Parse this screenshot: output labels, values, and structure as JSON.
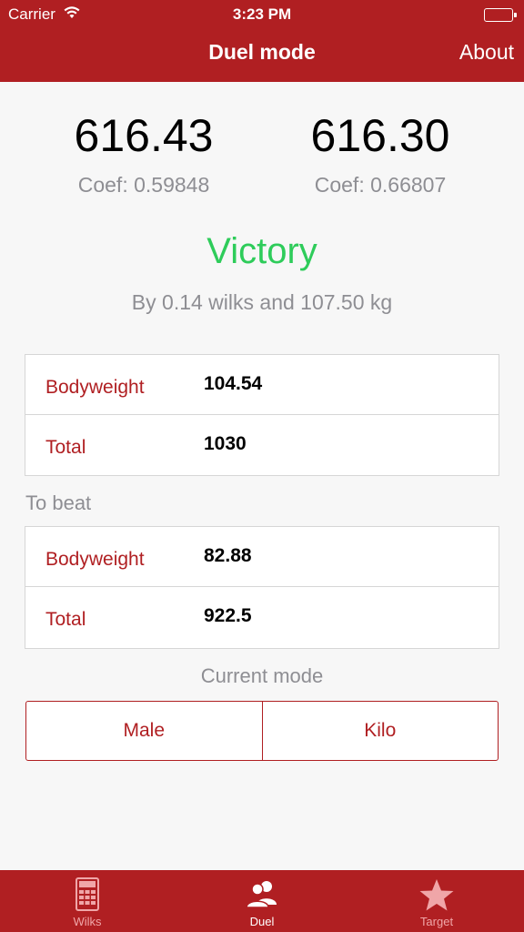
{
  "status_bar": {
    "carrier": "Carrier",
    "time": "3:23 PM"
  },
  "nav": {
    "title": "Duel mode",
    "about": "About"
  },
  "scores": {
    "left": {
      "value": "616.43",
      "coef": "Coef: 0.59848"
    },
    "right": {
      "value": "616.30",
      "coef": "Coef: 0.66807"
    }
  },
  "result": {
    "label": "Victory",
    "detail": "By 0.14 wilks and 107.50 kg"
  },
  "you": {
    "rows": [
      {
        "label": "Bodyweight",
        "value": "104.54"
      },
      {
        "label": "Total",
        "value": "1030"
      }
    ]
  },
  "to_beat": {
    "heading": "To beat",
    "rows": [
      {
        "label": "Bodyweight",
        "value": "82.88"
      },
      {
        "label": "Total",
        "value": "922.5"
      }
    ]
  },
  "mode": {
    "heading": "Current mode",
    "options": [
      "Male",
      "Kilo"
    ]
  },
  "tabs": [
    {
      "label": "Wilks",
      "icon": "calculator-icon"
    },
    {
      "label": "Duel",
      "icon": "users-icon"
    },
    {
      "label": "Target",
      "icon": "star-icon"
    }
  ],
  "colors": {
    "brand": "#b01f22",
    "victory": "#2ecc5a",
    "muted": "#8e8e93"
  }
}
